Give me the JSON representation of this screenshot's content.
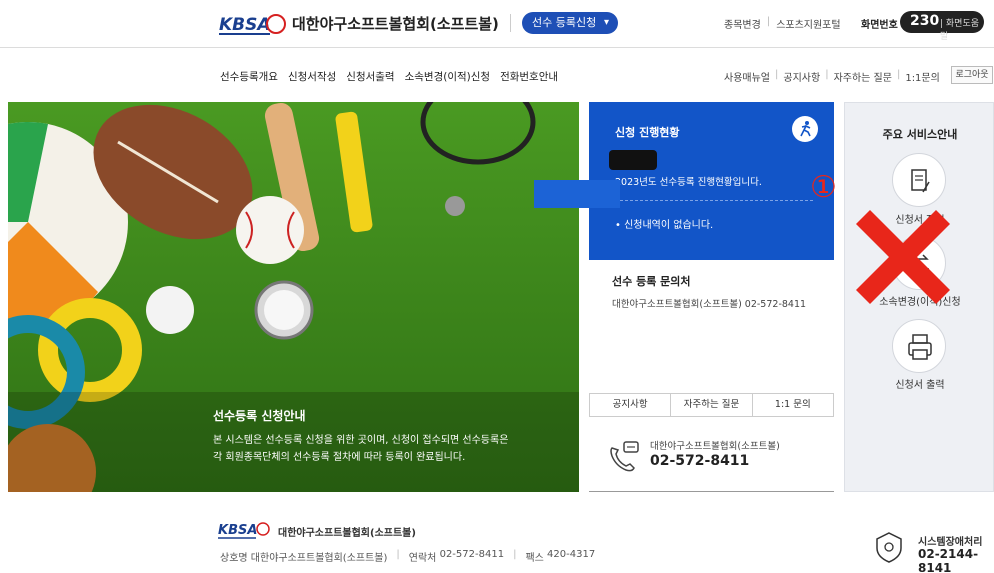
{
  "header": {
    "logo_text": "KBSA",
    "org_title": "대한야구소프트볼협회(소프트볼)",
    "system_select": "선수 등록신청",
    "util_links": [
      "종목변경",
      "스포츠지원포털"
    ],
    "screen_no_label": "화면번호",
    "screen_no": "230",
    "screen_help": "화면도움말"
  },
  "nav": {
    "items": [
      "선수등록개요",
      "신청서작성",
      "신청서출력",
      "소속변경(이적)신청",
      "전화번호안내"
    ],
    "util": [
      "사용매뉴얼",
      "공지사항",
      "자주하는 질문",
      "1:1문의"
    ],
    "logout": "로그아웃"
  },
  "hero": {
    "title": "선수등록 신청안내",
    "body_line1": "본 시스템은 선수등록 신청을 위한 곳이며, 신청이 접수되면 선수등록은",
    "body_line2": "각 회원종목단체의 선수등록 절차에 따라 등록이 완료됩니다."
  },
  "status": {
    "title": "신청 진행현황",
    "year_text": "2023년도 선수등록 진행현황입니다.",
    "empty_text": "• 신청내역이 없습니다."
  },
  "annotation": {
    "marker": "①"
  },
  "inquiry": {
    "title": "선수 등록 문의처",
    "body": "대한야구소프트볼협회(소프트볼)  02-572-8411",
    "tabs": [
      "공지사항",
      "자주하는 질문",
      "1:1 문의"
    ],
    "contact_org": "대한야구소프트볼협회(소프트볼)",
    "contact_tel": "02-572-8411"
  },
  "services": {
    "title": "주요 서비스안내",
    "items": [
      {
        "label": "신청서 작성",
        "icon": "document-edit-icon"
      },
      {
        "label": "소속변경(이적)신청",
        "icon": "transfer-icon"
      },
      {
        "label": "신청서 출력",
        "icon": "printer-icon"
      }
    ]
  },
  "footer": {
    "org": "대한야구소프트볼협회(소프트볼)",
    "company_label": "상호명",
    "company": "대한야구소프트볼협회(소프트볼)",
    "contact_label": "연락처",
    "contact": "02-572-8411",
    "fax_label": "팩스",
    "fax": "420-4317",
    "error_label": "시스템장애처리",
    "error_tel": "02-2144-8141"
  },
  "colors": {
    "brand_blue": "#1255c8",
    "annotation_red": "#e8261a"
  }
}
